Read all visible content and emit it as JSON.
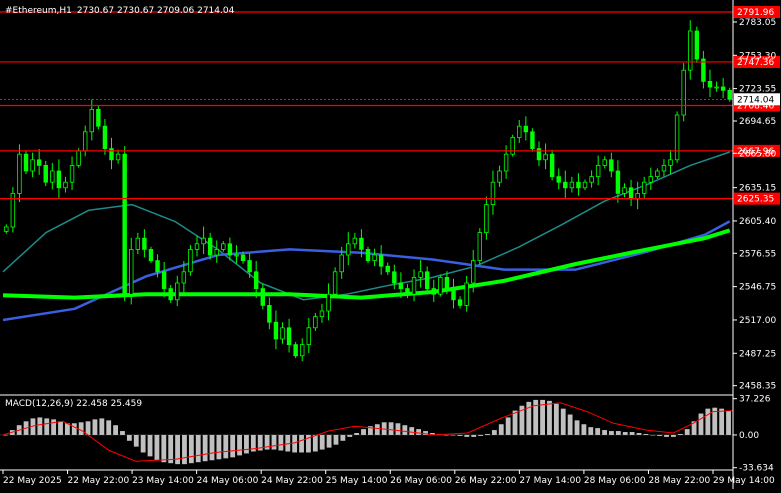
{
  "header": {
    "symbol_label": "#Ethereum,H1",
    "ohlc_label": "2730.67 2730.67 2709.06 2714.04"
  },
  "colors": {
    "background": "#000000",
    "axis": "#ffffff",
    "bull_candle": "#00ff00",
    "bear_candle": "#00ff00",
    "level_line": "#ff0000",
    "level_tag": "#ff0000",
    "price_tag": "#ffffff",
    "ma_fast": "#1f8a8a",
    "ma_mid": "#3a5fe0",
    "ma_slow": "#00ff00",
    "macd_hist": "#c0c0c0",
    "macd_signal": "#ff0000"
  },
  "chart_data": [
    {
      "type": "candlestick",
      "name": "price",
      "ylim": [
        2450,
        2800
      ],
      "y_ticks": [
        "2783.05",
        "2753.30",
        "2723.55",
        "2694.65",
        "2665.80",
        "2635.15",
        "2605.40",
        "2576.55",
        "2546.75",
        "2517.00",
        "2487.25",
        "2458.35"
      ],
      "x_labels": [
        "22 May 2025",
        "22 May 22:00",
        "23 May 14:00",
        "24 May 06:00",
        "24 May 22:00",
        "25 May 14:00",
        "26 May 06:00",
        "26 May 22:00",
        "27 May 14:00",
        "28 May 06:00",
        "28 May 22:00",
        "29 May 14:00"
      ],
      "levels": [
        {
          "value": 2791.96,
          "label": "2791.96"
        },
        {
          "value": 2747.36,
          "label": "2747.36"
        },
        {
          "value": 2708.46,
          "label": "2708.46"
        },
        {
          "value": 2667.96,
          "label": "2667.96"
        },
        {
          "value": 2625.35,
          "label": "2625.35"
        }
      ],
      "current_price": {
        "value": 2714.04,
        "label": "2714.04"
      },
      "closes": [
        2600,
        2630,
        2665,
        2650,
        2660,
        2655,
        2640,
        2650,
        2635,
        2640,
        2655,
        2668,
        2685,
        2705,
        2690,
        2670,
        2660,
        2665,
        2540,
        2580,
        2590,
        2580,
        2570,
        2560,
        2545,
        2535,
        2550,
        2560,
        2580,
        2585,
        2590,
        2575,
        2580,
        2585,
        2575,
        2575,
        2570,
        2560,
        2545,
        2530,
        2515,
        2500,
        2510,
        2495,
        2485,
        2495,
        2510,
        2520,
        2525,
        2540,
        2560,
        2575,
        2585,
        2590,
        2580,
        2570,
        2575,
        2565,
        2560,
        2550,
        2545,
        2540,
        2555,
        2560,
        2545,
        2540,
        2555,
        2545,
        2535,
        2530,
        2550,
        2570,
        2595,
        2620,
        2640,
        2650,
        2665,
        2680,
        2690,
        2685,
        2670,
        2660,
        2665,
        2645,
        2640,
        2635,
        2640,
        2635,
        2640,
        2645,
        2655,
        2660,
        2650,
        2630,
        2635,
        2625,
        2630,
        2640,
        2645,
        2650,
        2655,
        2660,
        2700,
        2740,
        2775,
        2750,
        2730,
        2725,
        2725,
        2722,
        2714
      ],
      "ma_fast": [
        [
          0,
          2560
        ],
        [
          12,
          2595
        ],
        [
          24,
          2615
        ],
        [
          36,
          2620
        ],
        [
          48,
          2605
        ],
        [
          60,
          2580
        ],
        [
          72,
          2550
        ],
        [
          84,
          2535
        ],
        [
          96,
          2540
        ],
        [
          108,
          2548
        ],
        [
          120,
          2555
        ],
        [
          132,
          2565
        ],
        [
          144,
          2582
        ],
        [
          156,
          2602
        ],
        [
          168,
          2623
        ],
        [
          180,
          2638
        ],
        [
          192,
          2655
        ],
        [
          203,
          2667
        ]
      ],
      "ma_mid": [
        [
          0,
          2517
        ],
        [
          20,
          2527
        ],
        [
          40,
          2556
        ],
        [
          60,
          2575
        ],
        [
          80,
          2580
        ],
        [
          100,
          2577
        ],
        [
          120,
          2571
        ],
        [
          140,
          2562
        ],
        [
          160,
          2562
        ],
        [
          180,
          2578
        ],
        [
          196,
          2593
        ],
        [
          203,
          2605
        ]
      ],
      "ma_slow": [
        [
          0,
          2539
        ],
        [
          20,
          2537
        ],
        [
          40,
          2540
        ],
        [
          60,
          2540
        ],
        [
          80,
          2540
        ],
        [
          100,
          2537
        ],
        [
          120,
          2542
        ],
        [
          140,
          2552
        ],
        [
          160,
          2567
        ],
        [
          180,
          2580
        ],
        [
          196,
          2590
        ],
        [
          203,
          2597
        ]
      ]
    },
    {
      "type": "bar",
      "name": "MACD",
      "title_label": "MACD(12,26,9) 22.458 25.459",
      "ylim": [
        -36,
        40
      ],
      "y_ticks": [
        "37.226",
        "0.00",
        "-33.634"
      ],
      "histogram": [
        0,
        5,
        10,
        14,
        17,
        18,
        17,
        16,
        14,
        12,
        12,
        13,
        14,
        16,
        17,
        15,
        10,
        4,
        -6,
        -12,
        -18,
        -22,
        -26,
        -28,
        -29,
        -30,
        -30,
        -29,
        -28,
        -27,
        -26,
        -25,
        -24,
        -23,
        -21,
        -19,
        -17,
        -16,
        -15,
        -15,
        -16,
        -17,
        -18,
        -18,
        -18,
        -17,
        -15,
        -13,
        -10,
        -6,
        -2,
        2,
        6,
        9,
        11,
        13,
        13,
        12,
        10,
        8,
        6,
        4,
        2,
        1,
        0,
        0,
        -1,
        -2,
        -2,
        -1,
        1,
        5,
        11,
        18,
        25,
        30,
        34,
        36,
        36,
        35,
        32,
        27,
        21,
        15,
        11,
        8,
        7,
        5,
        4,
        4,
        3,
        3,
        2,
        1,
        0,
        -1,
        -2,
        -2,
        1,
        6,
        14,
        22,
        27,
        28,
        27,
        25
      ],
      "signal": [
        [
          0,
          0
        ],
        [
          10,
          10
        ],
        [
          18,
          14
        ],
        [
          24,
          4
        ],
        [
          32,
          -16
        ],
        [
          40,
          -27
        ],
        [
          52,
          -25
        ],
        [
          64,
          -18
        ],
        [
          76,
          -14
        ],
        [
          88,
          -8
        ],
        [
          98,
          4
        ],
        [
          106,
          9
        ],
        [
          118,
          5
        ],
        [
          130,
          0
        ],
        [
          140,
          2
        ],
        [
          150,
          17
        ],
        [
          160,
          30
        ],
        [
          168,
          33
        ],
        [
          176,
          24
        ],
        [
          184,
          12
        ],
        [
          194,
          5
        ],
        [
          202,
          2
        ],
        [
          208,
          12
        ],
        [
          214,
          24
        ],
        [
          220,
          25
        ]
      ]
    }
  ]
}
